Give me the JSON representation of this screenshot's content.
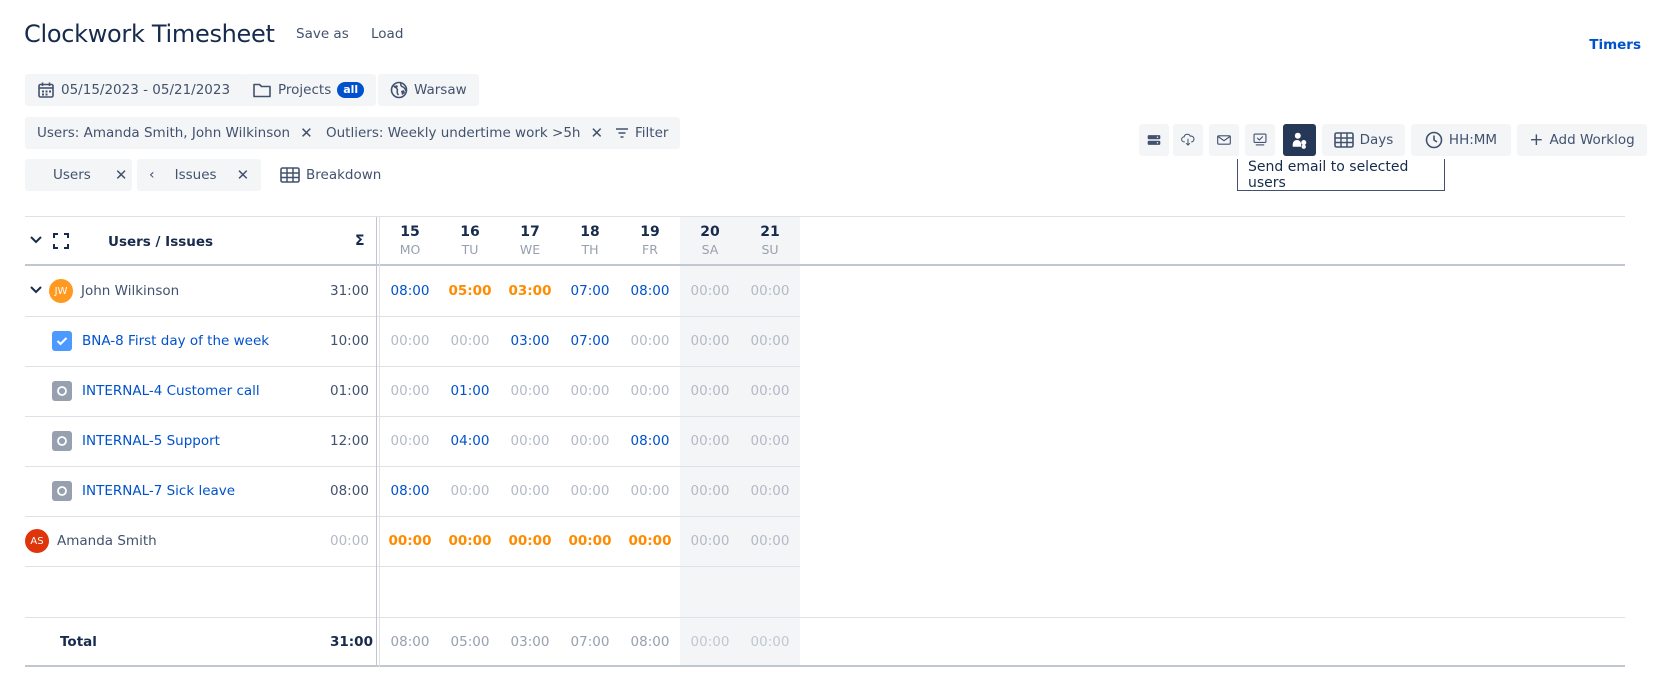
{
  "app": {
    "title": "Clockwork Timesheet",
    "save_as": "Save as",
    "load": "Load",
    "timers": "Timers"
  },
  "filters": {
    "date_range": "05/15/2023 - 05/21/2023",
    "projects_label": "Projects",
    "projects_badge": "all",
    "timezone": "Warsaw",
    "users_filter": "Users: Amanda Smith, John Wilkinson",
    "outliers_filter": "Outliers: Weekly undertime work >5h",
    "filter_button": "Filter",
    "group_users": "Users",
    "group_issues": "Issues",
    "breakdown": "Breakdown"
  },
  "toolbar": {
    "days": "Days",
    "time_format": "HH:MM",
    "add_worklog": "Add Worklog",
    "tooltip": "Send email to selected users"
  },
  "table": {
    "header_label": "Users / Issues",
    "sum_symbol": "Σ",
    "days": [
      {
        "num": "15",
        "wd": "MO"
      },
      {
        "num": "16",
        "wd": "TU"
      },
      {
        "num": "17",
        "wd": "WE"
      },
      {
        "num": "18",
        "wd": "TH"
      },
      {
        "num": "19",
        "wd": "FR"
      },
      {
        "num": "20",
        "wd": "SA"
      },
      {
        "num": "21",
        "wd": "SU"
      }
    ],
    "rows": [
      {
        "type": "user",
        "name": "John Wilkinson",
        "initials": "JW",
        "avatar_color": "#ff991f",
        "total": "31:00",
        "cells": [
          "08:00",
          "05:00",
          "03:00",
          "07:00",
          "08:00",
          "00:00",
          "00:00"
        ],
        "styles": [
          "blue-b",
          "orange",
          "orange",
          "blue-b",
          "blue-b",
          "gray",
          "gray"
        ]
      },
      {
        "type": "issue",
        "name": "BNA-8 First day of the week",
        "icon": "checkbox-icon",
        "icon_color": "#4c9aff",
        "total": "10:00",
        "cells": [
          "00:00",
          "00:00",
          "03:00",
          "07:00",
          "00:00",
          "00:00",
          "00:00"
        ],
        "styles": [
          "gray",
          "gray",
          "blue",
          "blue",
          "gray",
          "gray",
          "gray"
        ]
      },
      {
        "type": "issue",
        "name": "INTERNAL-4 Customer call",
        "icon": "circle-issue-icon",
        "icon_color": "#97a0af",
        "total": "01:00",
        "cells": [
          "00:00",
          "01:00",
          "00:00",
          "00:00",
          "00:00",
          "00:00",
          "00:00"
        ],
        "styles": [
          "gray",
          "blue",
          "gray",
          "gray",
          "gray",
          "gray",
          "gray"
        ]
      },
      {
        "type": "issue",
        "name": "INTERNAL-5 Support",
        "icon": "circle-issue-icon",
        "icon_color": "#97a0af",
        "total": "12:00",
        "cells": [
          "00:00",
          "04:00",
          "00:00",
          "00:00",
          "08:00",
          "00:00",
          "00:00"
        ],
        "styles": [
          "gray",
          "blue",
          "gray",
          "gray",
          "blue",
          "gray",
          "gray"
        ]
      },
      {
        "type": "issue",
        "name": "INTERNAL-7 Sick leave",
        "icon": "circle-issue-icon",
        "icon_color": "#97a0af",
        "total": "08:00",
        "cells": [
          "08:00",
          "00:00",
          "00:00",
          "00:00",
          "00:00",
          "00:00",
          "00:00"
        ],
        "styles": [
          "blue",
          "gray",
          "gray",
          "gray",
          "gray",
          "gray",
          "gray"
        ]
      },
      {
        "type": "user",
        "name": "Amanda Smith",
        "initials": "AS",
        "avatar_color": "#de350b",
        "total": "00:00",
        "cells": [
          "00:00",
          "00:00",
          "00:00",
          "00:00",
          "00:00",
          "00:00",
          "00:00"
        ],
        "styles": [
          "orange",
          "orange",
          "orange",
          "orange",
          "orange",
          "gray",
          "gray"
        ]
      }
    ],
    "total_label": "Total",
    "total_sum": "31:00",
    "total_cells": [
      "08:00",
      "05:00",
      "03:00",
      "07:00",
      "08:00",
      "00:00",
      "00:00"
    ]
  },
  "colors": {
    "accent": "#0052cc",
    "undertime": "#ff8b00",
    "toolbar_active": "#253858"
  }
}
